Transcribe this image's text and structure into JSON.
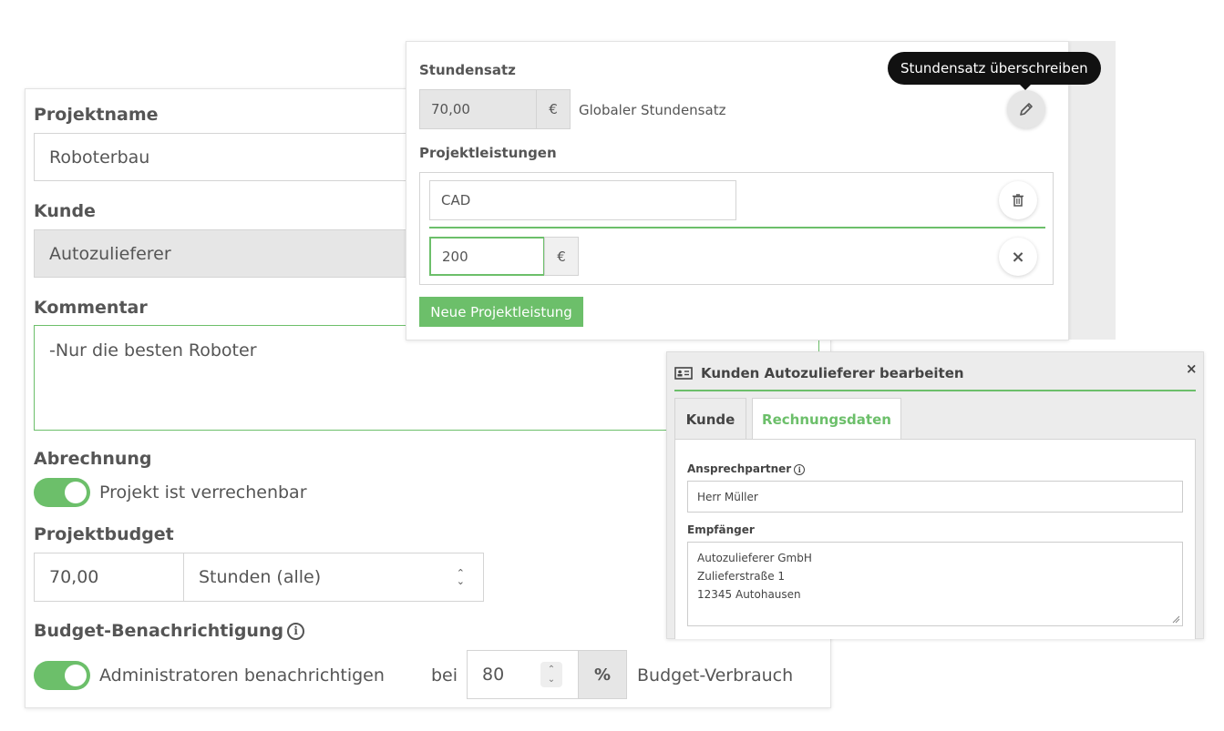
{
  "project": {
    "name_label": "Projektname",
    "name_value": "Roboterbau",
    "customer_label": "Kunde",
    "customer_value": "Autozulieferer",
    "comment_label": "Kommentar",
    "comment_value": "-Nur die besten Roboter",
    "billing_label": "Abrechnung",
    "billable_toggle": {
      "label": "Projekt ist verrechenbar",
      "on": true
    },
    "budget_label": "Projektbudget",
    "budget_value": "70,00",
    "budget_unit": "Stunden (alle)",
    "notify_label": "Budget-Benachrichtigung",
    "notify_toggle": {
      "label": "Administratoren benachrichtigen",
      "on": true
    },
    "notify_at_label": "bei",
    "notify_threshold": "80",
    "notify_unit": "%",
    "notify_suffix": "Budget-Verbrauch"
  },
  "rate": {
    "label": "Stundensatz",
    "value": "70,00",
    "currency": "€",
    "note": "Globaler Stundensatz",
    "override_tooltip": "Stundensatz überschreiben",
    "services_label": "Projektleistungen",
    "service_name": "CAD",
    "service_rate": "200",
    "service_currency": "€",
    "new_service_button": "Neue Projektleistung"
  },
  "customer_dialog": {
    "title": "Kunden Autozulieferer bearbeiten",
    "close": "×",
    "tabs": [
      {
        "label": "Kunde",
        "active": false
      },
      {
        "label": "Rechnungsdaten",
        "active": true
      }
    ],
    "contact_label": "Ansprechpartner",
    "contact_value": "Herr Müller",
    "recipient_label": "Empfänger",
    "recipient_lines": [
      "Autozulieferer GmbH",
      "Zulieferstraße 1",
      "12345 Autohausen"
    ]
  },
  "colors": {
    "accent_green": "#6cbf6a",
    "tooltip_bg": "#111111",
    "disabled_bg": "#e6e6e6"
  }
}
